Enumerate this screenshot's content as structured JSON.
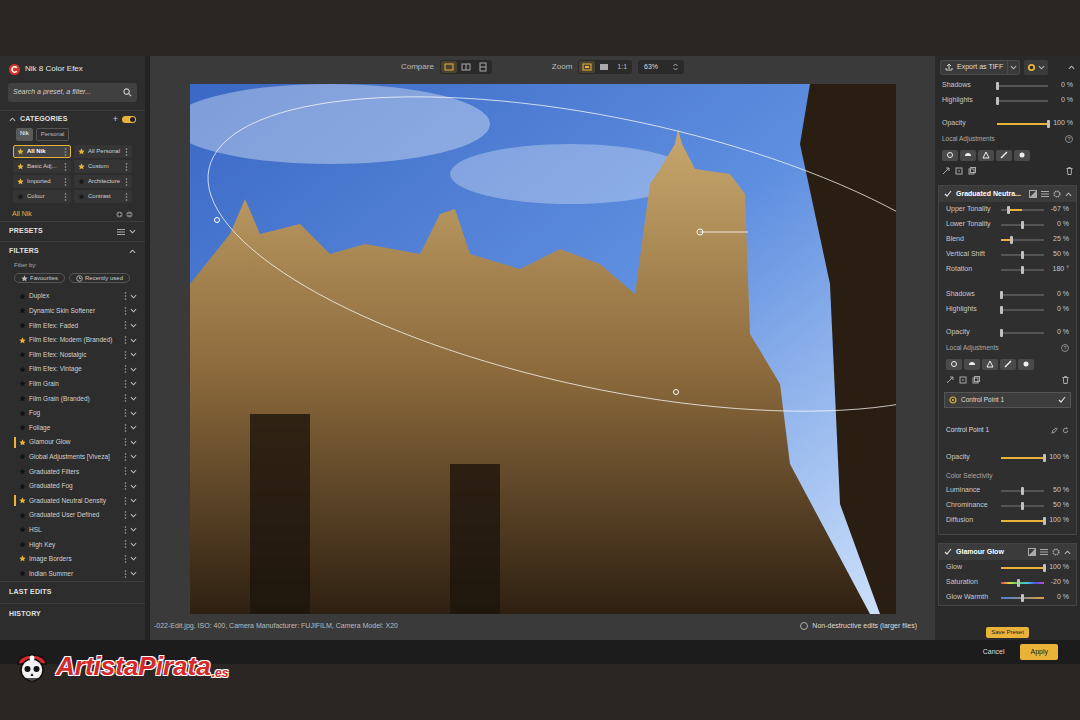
{
  "app": {
    "title": "Nik 8 Color Efex"
  },
  "search": {
    "placeholder": "Search a preset, a filter..."
  },
  "categories": {
    "title": "CATEGORIES",
    "add": "+",
    "toggle_on": true,
    "tabs": [
      {
        "label": "Nik",
        "selected": true
      },
      {
        "label": "Personal",
        "selected": false
      }
    ],
    "items": [
      {
        "label": "All Nik",
        "selected": true,
        "favourite": true
      },
      {
        "label": "All Personal",
        "selected": false,
        "favourite": true
      },
      {
        "label": "Basic Adj...",
        "selected": false,
        "favourite": true
      },
      {
        "label": "Custom",
        "selected": false,
        "favourite": true
      },
      {
        "label": "Imported",
        "selected": false,
        "favourite": true
      },
      {
        "label": "Architecture",
        "selected": false,
        "favourite": false
      },
      {
        "label": "Colour",
        "selected": false,
        "favourite": false
      },
      {
        "label": "Contrast",
        "selected": false,
        "favourite": false
      }
    ],
    "current": "All Nik"
  },
  "presets": {
    "title": "PRESETS"
  },
  "filters": {
    "title": "FILTERS",
    "filter_by": "Filter by:",
    "chips": [
      "Favourites",
      "Recently used"
    ],
    "items": [
      {
        "label": "Duplex",
        "favourite": false,
        "applied": false
      },
      {
        "label": "Dynamic Skin Softener",
        "favourite": false,
        "applied": false
      },
      {
        "label": "Film Efex: Faded",
        "favourite": false,
        "applied": false
      },
      {
        "label": "Film Efex: Modern (Branded)",
        "favourite": true,
        "applied": false
      },
      {
        "label": "Film Efex: Nostalgic",
        "favourite": false,
        "applied": false
      },
      {
        "label": "Film Efex: Vintage",
        "favourite": false,
        "applied": false
      },
      {
        "label": "Film Grain",
        "favourite": false,
        "applied": false
      },
      {
        "label": "Film Grain (Branded)",
        "favourite": false,
        "applied": false
      },
      {
        "label": "Fog",
        "favourite": false,
        "applied": false
      },
      {
        "label": "Foliage",
        "favourite": false,
        "applied": false
      },
      {
        "label": "Glamour Glow",
        "favourite": true,
        "applied": true
      },
      {
        "label": "Global Adjustments [Viveza]",
        "favourite": false,
        "applied": false
      },
      {
        "label": "Graduated Filters",
        "favourite": false,
        "applied": false
      },
      {
        "label": "Graduated Fog",
        "favourite": false,
        "applied": false
      },
      {
        "label": "Graduated Neutral Density",
        "favourite": true,
        "applied": true
      },
      {
        "label": "Graduated User Defined",
        "favourite": false,
        "applied": false
      },
      {
        "label": "HSL",
        "favourite": false,
        "applied": false
      },
      {
        "label": "High Key",
        "favourite": false,
        "applied": false
      },
      {
        "label": "Image Borders",
        "favourite": true,
        "applied": false
      },
      {
        "label": "Indian Summer",
        "favourite": false,
        "applied": false
      }
    ]
  },
  "sections": [
    "LAST EDITS",
    "HISTORY"
  ],
  "toolbar": {
    "compare": "Compare",
    "compare_modes": [
      {
        "selected": true
      },
      {
        "selected": false
      },
      {
        "selected": false
      }
    ],
    "zoom": "Zoom",
    "zoom_modes": [
      {
        "selected": true
      },
      {
        "selected": false
      }
    ],
    "zoom_actual": "1:1",
    "zoom_value": "63%"
  },
  "status": {
    "file": "-022-Edit.jpg, ISO: 400, Camera Manufacturer: FUJIFILM, Camera Model: X20",
    "option": "Non-destructive edits (larger files)",
    "checked": false
  },
  "export": {
    "label": "Export as TIFF"
  },
  "panel": {
    "top_rows": [
      {
        "label": "Shadows",
        "value": "0 %",
        "level": 0,
        "kind": "plain"
      },
      {
        "label": "Highlights",
        "value": "0 %",
        "level": 0,
        "kind": "plain"
      },
      {
        "label": "Opacity",
        "value": "100 %",
        "level": 1,
        "kind": "fill"
      }
    ],
    "top_local": {
      "title": "Local Adjustments",
      "help": "?"
    },
    "gnd": {
      "name": "Graduated Neutra...",
      "enabled": true,
      "expanded": true,
      "rows": [
        {
          "label": "Upper Tonality",
          "value": "-67 %",
          "level": 0.165,
          "kind": "bipolar"
        },
        {
          "label": "Lower Tonality",
          "value": "0 %",
          "level": 0.5,
          "kind": "bipolar"
        },
        {
          "label": "Blend",
          "value": "25 %",
          "level": 0.25,
          "kind": "fill"
        },
        {
          "label": "Vertical Shift",
          "value": "50 %",
          "level": 0.5,
          "kind": "plain"
        },
        {
          "label": "Rotation",
          "value": "180 °",
          "level": 0.5,
          "kind": "plain"
        }
      ],
      "tone_rows": [
        {
          "label": "Shadows",
          "value": "0 %",
          "level": 0,
          "kind": "plain"
        },
        {
          "label": "Highlights",
          "value": "0 %",
          "level": 0,
          "kind": "plain"
        },
        {
          "label": "Opacity",
          "value": "0 %",
          "level": 0,
          "kind": "plain"
        }
      ],
      "local_title": "Local Adjustments",
      "help": "?",
      "points": [
        {
          "label": "Control Point 1",
          "selected": true,
          "enabled": true
        }
      ],
      "point_name": "Control Point 1",
      "point_rows": [
        {
          "label": "Opacity",
          "value": "100 %",
          "level": 1,
          "kind": "fill"
        }
      ],
      "selectivity_title": "Color Selectivity",
      "selectivity_rows": [
        {
          "label": "Luminance",
          "value": "50 %",
          "level": 0.5,
          "kind": "plain"
        },
        {
          "label": "Chrominance",
          "value": "50 %",
          "level": 0.5,
          "kind": "plain"
        },
        {
          "label": "Diffusion",
          "value": "100 %",
          "level": 1,
          "kind": "fill"
        }
      ]
    },
    "glamour": {
      "name": "Glamour Glow",
      "enabled": true,
      "expanded": true,
      "rows": [
        {
          "label": "Glow",
          "value": "100 %",
          "level": 1,
          "kind": "fill"
        },
        {
          "label": "Saturation",
          "value": "-20 %",
          "level": 0.4,
          "kind": "hue"
        },
        {
          "label": "Glow Warmth",
          "value": "0 %",
          "level": 0.5,
          "kind": "warm"
        }
      ]
    }
  },
  "footer": {
    "save_preset": "Save Preset",
    "cancel": "Cancel",
    "apply": "Apply"
  },
  "watermark": {
    "name": "ArtistaPirata",
    "suffix": ".es"
  }
}
